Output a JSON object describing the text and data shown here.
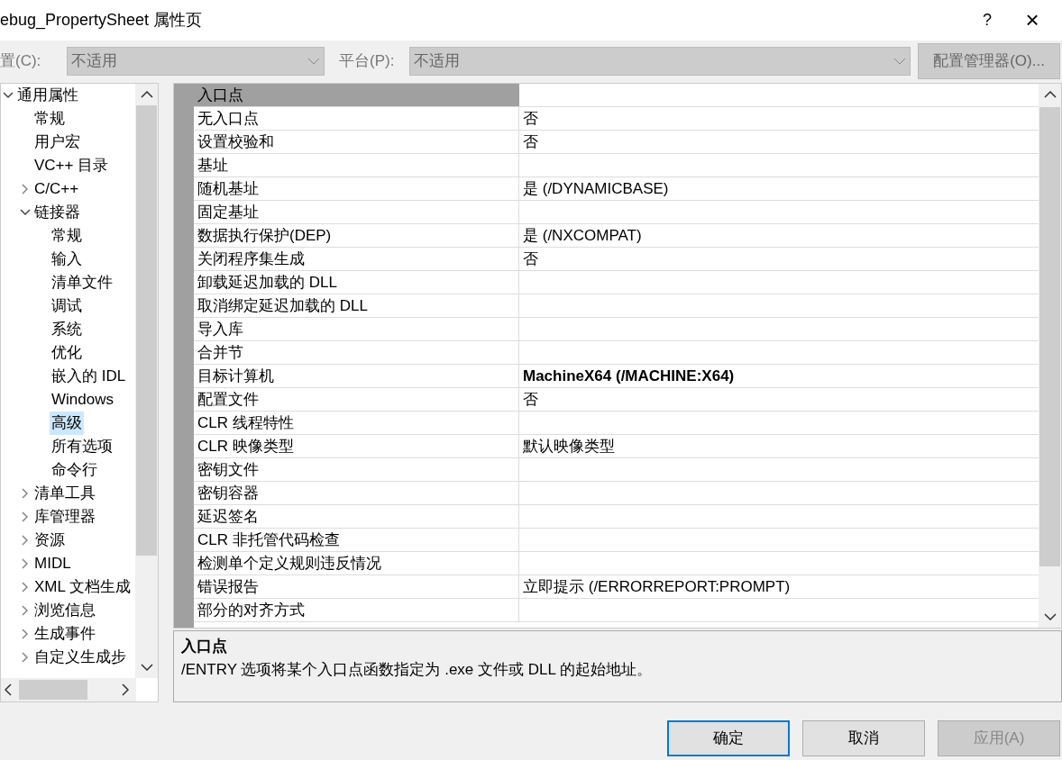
{
  "window": {
    "title": "ebug_PropertySheet 属性页",
    "help": "?",
    "close": "×"
  },
  "toolbar": {
    "config_label": "置(C):",
    "config_value": "不适用",
    "platform_label": "平台(P):",
    "platform_value": "不适用",
    "manager_button": "配置管理器(O)..."
  },
  "tree": [
    {
      "label": "通用属性",
      "expanded": true,
      "selected": false,
      "children": [
        {
          "label": "常规",
          "selected": false
        },
        {
          "label": "用户宏",
          "selected": false
        },
        {
          "label": "VC++ 目录",
          "selected": false
        },
        {
          "label": "C/C++",
          "expanded": false,
          "selected": false
        },
        {
          "label": "链接器",
          "expanded": true,
          "selected": false,
          "children": [
            {
              "label": "常规",
              "selected": false
            },
            {
              "label": "输入",
              "selected": false
            },
            {
              "label": "清单文件",
              "selected": false
            },
            {
              "label": "调试",
              "selected": false
            },
            {
              "label": "系统",
              "selected": false
            },
            {
              "label": "优化",
              "selected": false
            },
            {
              "label": "嵌入的 IDL",
              "selected": false
            },
            {
              "label": "Windows",
              "selected": false
            },
            {
              "label": "高级",
              "selected": true
            },
            {
              "label": "所有选项",
              "selected": false
            },
            {
              "label": "命令行",
              "selected": false
            }
          ]
        },
        {
          "label": "清单工具",
          "expanded": false,
          "selected": false
        },
        {
          "label": "库管理器",
          "expanded": false,
          "selected": false
        },
        {
          "label": "资源",
          "expanded": false,
          "selected": false
        },
        {
          "label": "MIDL",
          "expanded": false,
          "selected": false
        },
        {
          "label": "XML 文档生成",
          "expanded": false,
          "selected": false
        },
        {
          "label": "浏览信息",
          "expanded": false,
          "selected": false
        },
        {
          "label": "生成事件",
          "expanded": false,
          "selected": false
        },
        {
          "label": "自定义生成步",
          "expanded": false,
          "selected": false
        }
      ]
    }
  ],
  "grid": {
    "category": "入口点",
    "rows": [
      {
        "name": "无入口点",
        "value": "否"
      },
      {
        "name": "设置校验和",
        "value": "否"
      },
      {
        "name": "基址"
      },
      {
        "name": "随机基址",
        "value": "是 (/DYNAMICBASE)"
      },
      {
        "name": "固定基址"
      },
      {
        "name": "数据执行保护(DEP)",
        "value": "是 (/NXCOMPAT)"
      },
      {
        "name": "关闭程序集生成",
        "value": "否"
      },
      {
        "name": "卸载延迟加载的 DLL"
      },
      {
        "name": "取消绑定延迟加载的 DLL"
      },
      {
        "name": "导入库"
      },
      {
        "name": "合并节"
      },
      {
        "name": "目标计算机",
        "value": "MachineX64 (/MACHINE:X64)",
        "bold": true
      },
      {
        "name": "配置文件",
        "value": "否"
      },
      {
        "name": "CLR 线程特性"
      },
      {
        "name": "CLR 映像类型",
        "value": "默认映像类型"
      },
      {
        "name": "密钥文件"
      },
      {
        "name": "密钥容器"
      },
      {
        "name": "延迟签名"
      },
      {
        "name": "CLR 非托管代码检查"
      },
      {
        "name": "检测单个定义规则违反情况"
      },
      {
        "name": "错误报告",
        "value": "立即提示 (/ERRORREPORT:PROMPT)"
      },
      {
        "name": "部分的对齐方式"
      }
    ]
  },
  "description": {
    "title": "入口点",
    "text": "/ENTRY 选项将某个入口点函数指定为 .exe 文件或 DLL 的起始地址。"
  },
  "buttons": [
    {
      "label": "确定",
      "kind": "default",
      "disabled": false
    },
    {
      "label": "取消",
      "kind": "normal",
      "disabled": false
    },
    {
      "label": "应用(A)",
      "kind": "normal",
      "disabled": true
    }
  ]
}
